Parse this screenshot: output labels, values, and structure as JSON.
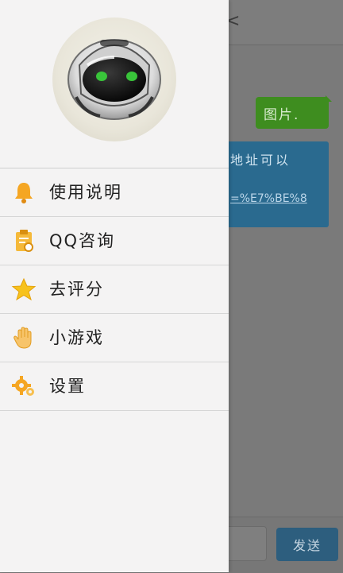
{
  "chat": {
    "back_glyph": "<",
    "bubble_right": "图片.",
    "bubble_left_line": "地址可以",
    "bubble_left_link": "=%E7%BE%8",
    "send_label": "发送"
  },
  "drawer": {
    "menu": [
      {
        "label": "使用说明",
        "icon": "bell-icon"
      },
      {
        "label": "QQ咨询",
        "icon": "clipboard-icon"
      },
      {
        "label": "去评分",
        "icon": "star-icon"
      },
      {
        "label": "小游戏",
        "icon": "hand-icon"
      },
      {
        "label": "设置",
        "icon": "gear-icon"
      }
    ]
  },
  "colors": {
    "accent_orange": "#f5a623",
    "bubble_green": "#3e8d1f",
    "bubble_blue": "#2a6a8f",
    "drawer_bg": "#f4f3f3"
  }
}
